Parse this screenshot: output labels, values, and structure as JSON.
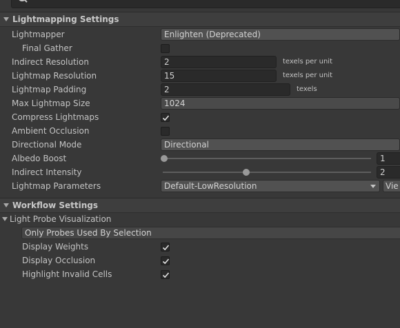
{
  "lightmapping": {
    "header": "Lightmapping Settings",
    "lightmapper": {
      "label": "Lightmapper",
      "value": "Enlighten (Deprecated)"
    },
    "final_gather": {
      "label": "Final Gather",
      "checked": false
    },
    "indirect_resolution": {
      "label": "Indirect Resolution",
      "value": "2",
      "unit": "texels per unit"
    },
    "lightmap_resolution": {
      "label": "Lightmap Resolution",
      "value": "15",
      "unit": "texels per unit"
    },
    "lightmap_padding": {
      "label": "Lightmap Padding",
      "value": "2",
      "unit": "texels"
    },
    "max_lightmap_size": {
      "label": "Max Lightmap Size",
      "value": "1024"
    },
    "compress_lightmaps": {
      "label": "Compress Lightmaps",
      "checked": true
    },
    "ambient_occlusion": {
      "label": "Ambient Occlusion",
      "checked": false
    },
    "directional_mode": {
      "label": "Directional Mode",
      "value": "Directional"
    },
    "albedo_boost": {
      "label": "Albedo Boost",
      "value": "1",
      "slider_fraction": 0
    },
    "indirect_intensity": {
      "label": "Indirect Intensity",
      "value": "2",
      "slider_fraction": 0.4
    },
    "lightmap_parameters": {
      "label": "Lightmap Parameters",
      "value": "Default-LowResolution",
      "view_button": "Vie"
    }
  },
  "workflow": {
    "header": "Workflow Settings",
    "light_probe_visualization": {
      "label": "Light Probe Visualization",
      "mode": "Only Probes Used By Selection",
      "display_weights": {
        "label": "Display Weights",
        "checked": true
      },
      "display_occlusion": {
        "label": "Display Occlusion",
        "checked": true
      },
      "highlight_invalid_cells": {
        "label": "Highlight Invalid Cells",
        "checked": true
      }
    }
  },
  "colors": {
    "background": "#383838",
    "field": "#2a2a2a",
    "header": "#3e3e3e",
    "text": "#c4c4c4"
  }
}
